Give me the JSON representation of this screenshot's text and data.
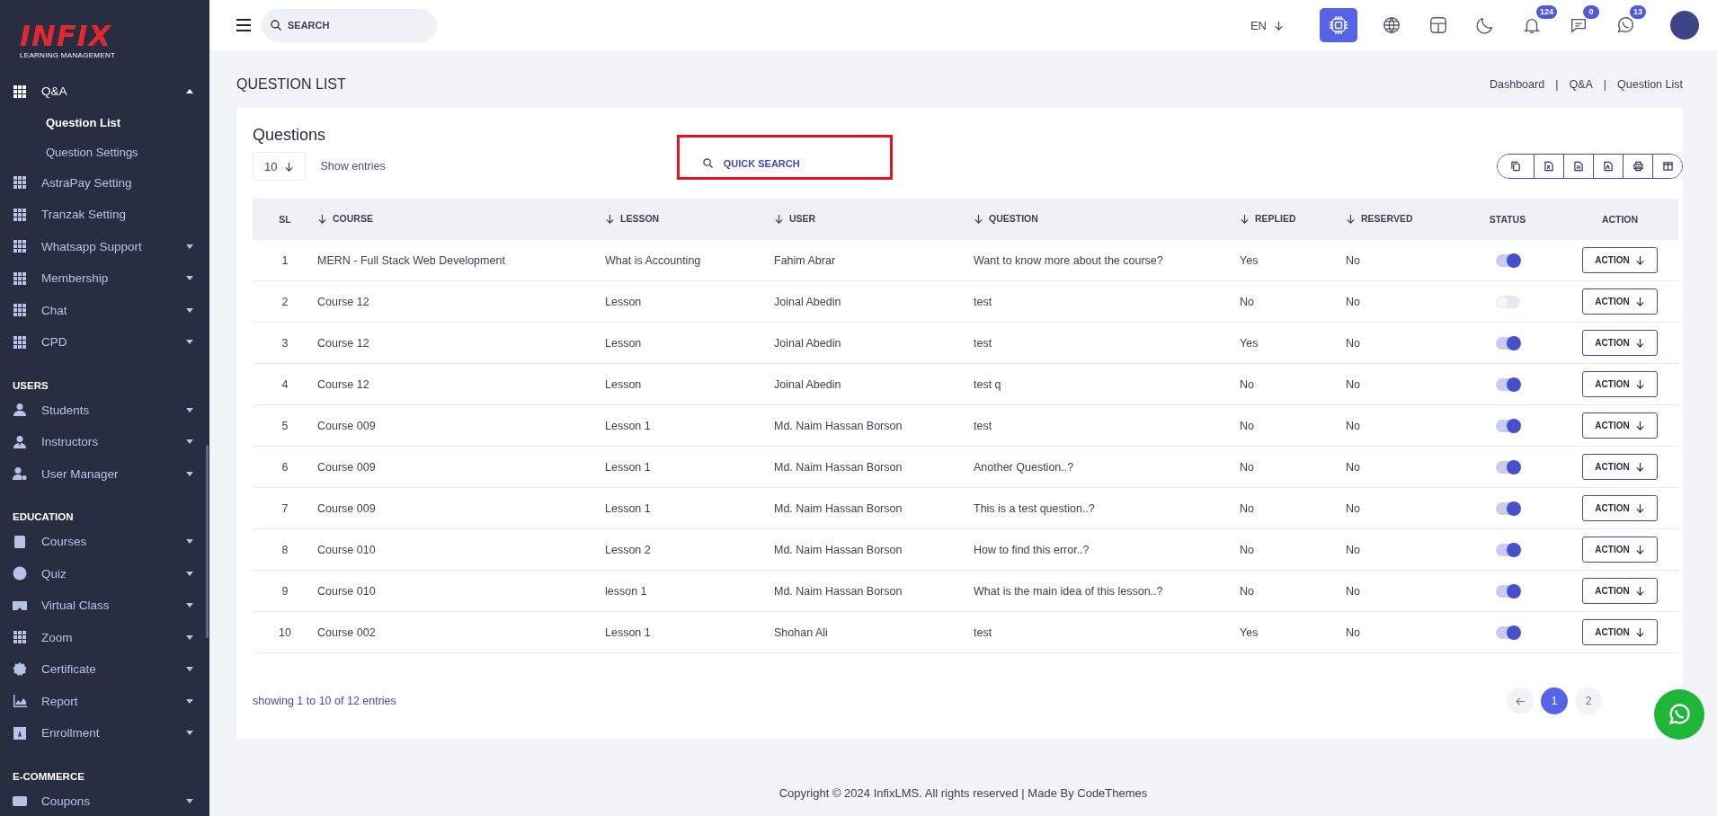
{
  "logo": {
    "title": "INFIX",
    "subtitle": "LEARNING MANAGEMENT"
  },
  "sidebar": {
    "sections": [
      {
        "items": [
          {
            "label": "Q&A",
            "kind": "menu",
            "expanded": true,
            "children": [
              {
                "label": "Question List",
                "selected": true
              },
              {
                "label": "Question Settings",
                "selected": false
              }
            ]
          },
          {
            "label": "AstraPay Setting",
            "kind": "link"
          },
          {
            "label": "Tranzak Setting",
            "kind": "link"
          },
          {
            "label": "Whatsapp Support",
            "kind": "menu",
            "expanded": false
          },
          {
            "label": "Membership",
            "kind": "menu",
            "expanded": false
          },
          {
            "label": "Chat",
            "kind": "menu",
            "expanded": false
          },
          {
            "label": "CPD",
            "kind": "menu",
            "expanded": false
          }
        ]
      },
      {
        "title": "USERS",
        "items": [
          {
            "label": "Students",
            "kind": "menu",
            "expanded": false
          },
          {
            "label": "Instructors",
            "kind": "menu",
            "expanded": false
          },
          {
            "label": "User Manager",
            "kind": "menu",
            "expanded": false
          }
        ]
      },
      {
        "title": "EDUCATION",
        "items": [
          {
            "label": "Courses",
            "kind": "menu",
            "expanded": false
          },
          {
            "label": "Quiz",
            "kind": "menu",
            "expanded": false
          },
          {
            "label": "Virtual Class",
            "kind": "menu",
            "expanded": false
          },
          {
            "label": "Zoom",
            "kind": "menu",
            "expanded": false
          },
          {
            "label": "Certificate",
            "kind": "menu",
            "expanded": false
          },
          {
            "label": "Report",
            "kind": "menu",
            "expanded": false
          },
          {
            "label": "Enrollment",
            "kind": "menu",
            "expanded": false
          }
        ]
      },
      {
        "title": "E-COMMERCE",
        "items": [
          {
            "label": "Coupons",
            "kind": "menu",
            "expanded": false
          }
        ]
      }
    ]
  },
  "topbar": {
    "search": {
      "placeholder": "SEARCH"
    },
    "language": "EN",
    "badges": {
      "notifications": "124",
      "messages": "0",
      "whatsapp": "13"
    }
  },
  "page": {
    "title": "QUESTION LIST",
    "breadcrumbs": [
      {
        "label": "Dashboard",
        "separator": "|"
      },
      {
        "label": "Q&A",
        "separator": "|"
      },
      {
        "label": "Question List"
      }
    ]
  },
  "card": {
    "title": "Questions",
    "page_size": "10",
    "show_entries": "Show entries",
    "quick_search": {
      "placeholder": "QUICK SEARCH",
      "highlighted": true
    }
  },
  "table": {
    "columns": [
      {
        "label": "SL",
        "sortable": false
      },
      {
        "label": "COURSE",
        "sortable": true
      },
      {
        "label": "LESSON",
        "sortable": true
      },
      {
        "label": "USER",
        "sortable": true
      },
      {
        "label": "QUESTION",
        "sortable": true
      },
      {
        "label": "REPLIED",
        "sortable": true
      },
      {
        "label": "RESERVED",
        "sortable": true
      },
      {
        "label": "STATUS",
        "sortable": false
      },
      {
        "label": "ACTION",
        "sortable": false
      }
    ],
    "rows": [
      {
        "sl": "1",
        "course": "MERN - Full Stack Web Development",
        "lesson": "What is Accounting",
        "user": "Fahim Abrar",
        "question": "Want to know more about the course?",
        "replied": "Yes",
        "reserved": "No",
        "on": true,
        "action": "ACTION"
      },
      {
        "sl": "2",
        "course": "Course 12",
        "lesson": "Lesson",
        "user": "Joinal Abedin",
        "question": "test",
        "replied": "No",
        "reserved": "No",
        "on": false,
        "action": "ACTION"
      },
      {
        "sl": "3",
        "course": "Course 12",
        "lesson": "Lesson",
        "user": "Joinal Abedin",
        "question": "test",
        "replied": "Yes",
        "reserved": "No",
        "on": true,
        "action": "ACTION"
      },
      {
        "sl": "4",
        "course": "Course 12",
        "lesson": "Lesson",
        "user": "Joinal Abedin",
        "question": "test q",
        "replied": "No",
        "reserved": "No",
        "on": true,
        "action": "ACTION"
      },
      {
        "sl": "5",
        "course": "Course 009",
        "lesson": "Lesson 1",
        "user": "Md. Naim Hassan Borson",
        "question": "test",
        "replied": "No",
        "reserved": "No",
        "on": true,
        "action": "ACTION"
      },
      {
        "sl": "6",
        "course": "Course 009",
        "lesson": "Lesson 1",
        "user": "Md. Naim Hassan Borson",
        "question": "Another Question..?",
        "replied": "No",
        "reserved": "No",
        "on": true,
        "action": "ACTION"
      },
      {
        "sl": "7",
        "course": "Course 009",
        "lesson": "Lesson 1",
        "user": "Md. Naim Hassan Borson",
        "question": "This is a test question..?",
        "replied": "No",
        "reserved": "No",
        "on": true,
        "action": "ACTION"
      },
      {
        "sl": "8",
        "course": "Course 010",
        "lesson": "Lesson 2",
        "user": "Md. Naim Hassan Borson",
        "question": "How to find this error..?",
        "replied": "No",
        "reserved": "No",
        "on": true,
        "action": "ACTION"
      },
      {
        "sl": "9",
        "course": "Course 010",
        "lesson": "lesson 1",
        "user": "Md. Naim Hassan Borson",
        "question": "What is the main idea of this lesson..?",
        "replied": "No",
        "reserved": "No",
        "on": true,
        "action": "ACTION"
      },
      {
        "sl": "10",
        "course": "Course 002",
        "lesson": "Lesson 1",
        "user": "Shohan Ali",
        "question": "test",
        "replied": "Yes",
        "reserved": "No",
        "on": true,
        "action": "ACTION"
      }
    ]
  },
  "pagination": {
    "summary": "showing 1 to 10 of 12 entries",
    "pages": [
      {
        "label": "1",
        "selected": true
      },
      {
        "label": "2",
        "selected": false
      }
    ]
  },
  "footer": {
    "text": "Copyright © 2024 InfixLMS. All rights reserved | Made By CodeThemes"
  }
}
